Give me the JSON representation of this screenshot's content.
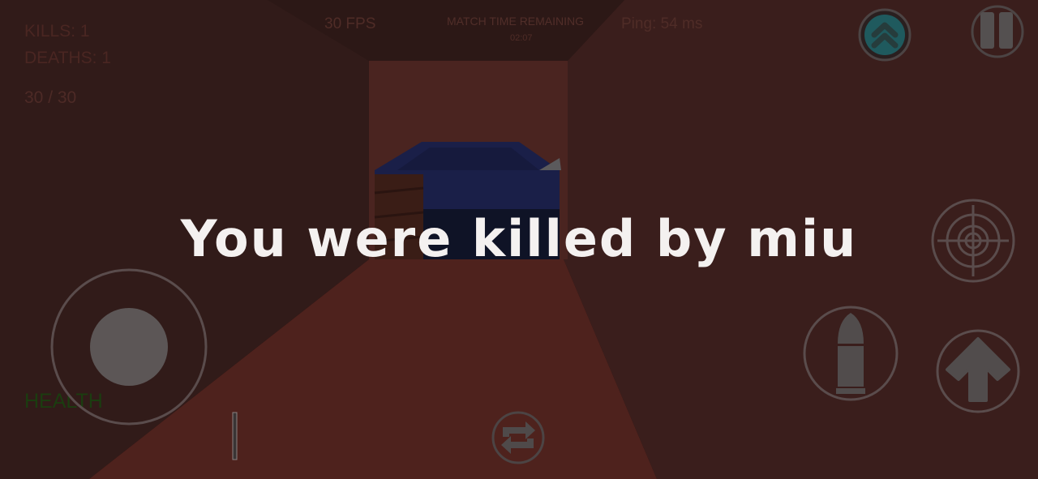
{
  "hud": {
    "kills": "KILLS: 1",
    "deaths": "DEATHS: 1",
    "ammo": "30 / 30",
    "fps": "30 FPS",
    "match_time_label": "MATCH TIME REMAINING",
    "match_time_value": "02:07",
    "ping": "Ping: 54 ms",
    "health_label": "HEALTH"
  },
  "death_message": "You were killed by miu",
  "colors": {
    "health_label": "#1b3d10",
    "wall": "#3a1d1b",
    "floor": "#6a2d24",
    "car": "#1a1f48",
    "button_outline": "#5a4a4a",
    "button_fill": "#4f4a4a",
    "rank_badge": "#1f5a5e"
  },
  "controls": {
    "move_joystick": "joystick",
    "rank_up_icon": "double-chevron-up-icon",
    "pause_icon": "pause-icon",
    "aim_icon": "crosshair-icon",
    "fire_icon": "bullet-icon",
    "jump_icon": "arrow-up-icon",
    "reload_icon": "swap-arrows-icon"
  }
}
